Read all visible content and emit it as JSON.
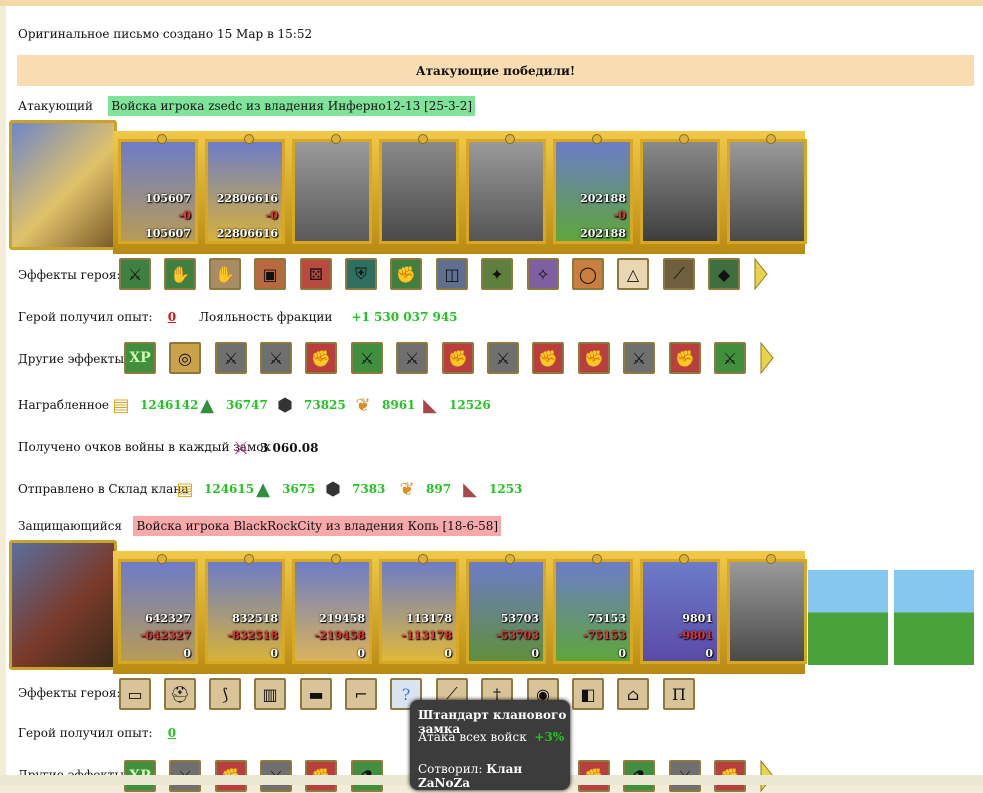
{
  "header": {
    "created": "Оригинальное письмо создано 15 Мар в 15:52",
    "result": "Атакующие победили!"
  },
  "attacker": {
    "label": "Атакующий",
    "army": "Войска игрока zsedc из владения Инферно12-13 [25-3-2]",
    "troops": [
      {
        "icon": "centaur-icon",
        "top": "105607",
        "mid": "-0",
        "bottom": "105607"
      },
      {
        "icon": "gold-golem-icon",
        "top": "22806616",
        "mid": "-0",
        "bottom": "22806616"
      },
      {
        "icon": "knight-icon",
        "top": "",
        "mid": "",
        "bottom": ""
      },
      {
        "icon": "pegasus-icon",
        "top": "",
        "mid": "",
        "bottom": ""
      },
      {
        "icon": "archer-icon",
        "top": "",
        "mid": "",
        "bottom": ""
      },
      {
        "icon": "druid-icon",
        "top": "202188",
        "mid": "-0",
        "bottom": "202188"
      },
      {
        "icon": "dwarf-icon",
        "top": "",
        "mid": "",
        "bottom": ""
      },
      {
        "icon": "ghost-icon",
        "top": "",
        "mid": "",
        "bottom": ""
      }
    ],
    "effects_label": "Эффекты героя:",
    "effects": [
      "sword-icon",
      "handshake-icon",
      "hand-icon",
      "chest-icon",
      "dice-icon",
      "shield-icon",
      "fist-shield-icon",
      "barrel-icon",
      "amulet-icon",
      "wings-icon",
      "ring-icon",
      "shell-icon",
      "staff-icon",
      "gem-icon"
    ],
    "xp_label": "Герой получил опыт:",
    "xp_value": "0",
    "loyalty_label": "Лояльность фракции",
    "loyalty_value": "+1 530 037 945",
    "other_label": "Другие эффекты:",
    "other_effects": [
      "xp-icon",
      "coins-icon",
      "sword-icon",
      "sword-icon",
      "fist-icon",
      "sword-green-icon",
      "sword-icon",
      "fist-icon",
      "sword-icon",
      "fist-icon",
      "fist-icon",
      "sword-icon",
      "fist-icon",
      "sword-green-icon"
    ],
    "loot_label": "Награбленное",
    "loot": [
      {
        "icon": "gold-icon",
        "value": "1246142"
      },
      {
        "icon": "wood-icon",
        "value": "36747"
      },
      {
        "icon": "ore-icon",
        "value": "73825"
      },
      {
        "icon": "wheat-icon",
        "value": "8961"
      },
      {
        "icon": "stone-icon",
        "value": "12526"
      }
    ],
    "war_label": "Получено очков войны в каждый замок",
    "war_value": "3 060.08",
    "clan_label": "Отправлено в Склад клана",
    "clan": [
      {
        "icon": "gold-icon",
        "value": "124615"
      },
      {
        "icon": "wood-icon",
        "value": "3675"
      },
      {
        "icon": "ore-icon",
        "value": "7383"
      },
      {
        "icon": "wheat-icon",
        "value": "897"
      },
      {
        "icon": "stone-icon",
        "value": "1253"
      }
    ]
  },
  "defender": {
    "label": "Защищающийся",
    "army": "Войска игрока BlackRockCity из владения Копь [18-6-58]",
    "troops": [
      {
        "icon": "centaur-icon",
        "top": "642327",
        "mid": "-642327",
        "bottom": "0"
      },
      {
        "icon": "gold-golem-icon",
        "top": "832518",
        "mid": "-832518",
        "bottom": "0"
      },
      {
        "icon": "knight-icon",
        "top": "219458",
        "mid": "-219458",
        "bottom": "0"
      },
      {
        "icon": "pegasus-icon",
        "top": "113178",
        "mid": "-113178",
        "bottom": "0"
      },
      {
        "icon": "archer-icon",
        "top": "53703",
        "mid": "-53703",
        "bottom": "0"
      },
      {
        "icon": "druid-icon",
        "top": "75153",
        "mid": "-75153",
        "bottom": "0"
      },
      {
        "icon": "paladin-icon",
        "top": "9801",
        "mid": "-9801",
        "bottom": "0"
      },
      {
        "icon": "ghost-icon",
        "top": "",
        "mid": "",
        "bottom": ""
      }
    ],
    "effects_label": "Эффекты героя:",
    "effects": [
      "scroll-icon",
      "helmet-icon",
      "claws-icon",
      "armor-icon",
      "belt-icon",
      "boots-icon",
      "question-icon",
      "blade-icon",
      "dagger-icon",
      "amulet-icon",
      "bracers-icon",
      "cloak-icon",
      "pants-icon"
    ],
    "xp_label": "Герой получил опыт:",
    "xp_value": "0",
    "other_label": "Другие эффекты:"
  },
  "tooltip": {
    "title": "Штандарт кланового замка",
    "line1": "Атака всех войск",
    "line1_value": "+3%",
    "line2": "Сотворил:",
    "line2_value": "Клан ZaNoZa"
  }
}
